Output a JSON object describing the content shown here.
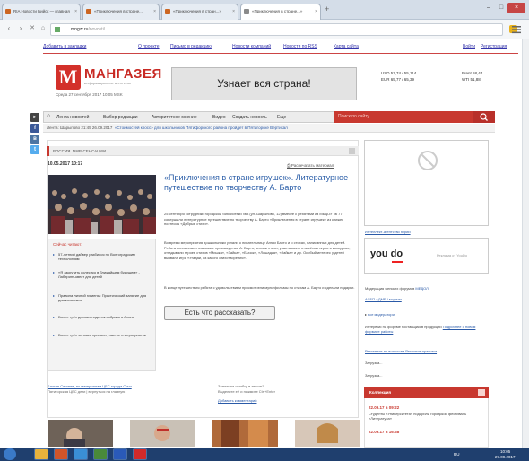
{
  "browser": {
    "tabs": [
      {
        "label": "RIA Новости Бийск — главная"
      },
      {
        "label": "«Приключения в стране..."
      },
      {
        "label": "«Приключения в стран...»"
      },
      {
        "label": "«Приключения в стране...»"
      }
    ],
    "new_tab_label": "+",
    "url_host": "mngzr.ru",
    "url_path": "/novosti/..."
  },
  "site": {
    "top_links": [
      "Добавить в закладки",
      "О проекте",
      "Письмо в редакцию",
      "Новости компаний",
      "Новости по RSS",
      "Карта сайта",
      "Войти",
      "Регистрация"
    ],
    "logo_letter": "М",
    "logo_name": "МАНГАЗЕЯ",
    "logo_tagline": "информационное агентство",
    "logo_date": "Среда 27 сентября 2017  10:05 MSK",
    "banner_text": "Узнает вся страна!",
    "rates": {
      "usd": "USD  57,74 / 55,114",
      "eur": "EUR  65,77 / 65,39",
      "brent": "Brent  58,44",
      "wti": "WTI  51,88"
    },
    "nav": [
      "Лента новостей",
      "Выбор редакции",
      "Авторитетное мнение",
      "Видео",
      "Создать новость",
      "Еще"
    ],
    "search_placeholder": "Поиск по сайту...",
    "ticker_date": "Лента: Шарыпово 21:45 26.09.2017",
    "ticker_text": "«Стоимостей кросс» для школьников Пятифорского района пройдет в Пятигорске Вертикал"
  },
  "article": {
    "section": "РОССИЯ. МИР. СЕНСАЦИИ",
    "date": "10.05.2017 10:17",
    "print_label": "Распечатать материал",
    "title": "«Приключения в стране игрушек». Литературное путешествие по творчеству А. Барто",
    "p1": "25 сентября сотрудники городской библиотеки №8 (ул. Шарыпово, 12) вместе с ребятами из МБДОУ № 77 совершили литературное путешествие по творчеству А. Барто «Приключения в стране игрушек» из книжек поэтессы «Добрые стихи».",
    "p2": "Во время мероприятия дошкольники узнали о писательнице Агнии Барто и о стихах, написанных для детей. Ребята вспоминали знакомые произведения А. Барто, читали стихи, участвовали в весёлых играх и конкурсах, отгадывали героев стихов «Мишка», «Зайка», «Бычок», «Лошадка», «Зайка» и др. Особый интерес у детей вызвала игра «Угадай, из какого стихотворения».",
    "p3": "В конце путешествия ребята с удовольствием просмотрели мультфильмы по стихам А. Барто и сделали подарки.",
    "tell_button": "Есть что рассказать?",
    "related_heading": "Сейчас читают:",
    "related": [
      "57-летний дайвер разбился по Волгоградским технологиям",
      "«Я закрутить колесико в ближайшем будущем» - Лабиринт-квест для детей",
      "Правила личной гигиены: Практический занятие для дошкольников",
      "Более трёх детских поделок собрано в Анапе",
      "Более трёх человек приняли участие в мероприятии"
    ],
    "foot_left": "Блогин Сергеев, по материалам ЦБС города Сочи",
    "foot_left2": "Пятигорская ЦБС дети | вернуться на главную",
    "foot_right": "Заметили ошибку в тексте?",
    "foot_right2": "Выделите её и нажмите Ctrl+Enter",
    "foot_right3": "Добавить комментарий"
  },
  "sidebar": {
    "ad_link": "Интеллект-агентство Юрий",
    "yandex_logo": "you do",
    "yandex_caption": "Реклама от YouDo",
    "links": [
      {
        "text": "Модерация женских форумов",
        "link": "МЕДОЛ"
      },
      {
        "text": "",
        "link": "АСБП АДМБ / модели"
      },
      {
        "text": "",
        "link": "все модератори"
      },
      {
        "text": "Интервью на форуме поставщиков продукции",
        "link": "Подробнее о новом формате работы"
      },
      {
        "text": "",
        "link": "Регламент по вопросам Регионов практики"
      },
      {
        "text": "Загрузка..."
      },
      {
        "text": "Загрузка..."
      }
    ],
    "collection_heading": "Коллекция",
    "coll_date": "22.09.17 в 09:22",
    "coll_text": "Студенты «Университета» подарили городской фестиваль «Литература»",
    "coll_date2": "22.09.17 в 16:38"
  },
  "taskbar": {
    "clock_time": "10:05",
    "clock_date": "27.09.2017",
    "lang": "RU"
  }
}
